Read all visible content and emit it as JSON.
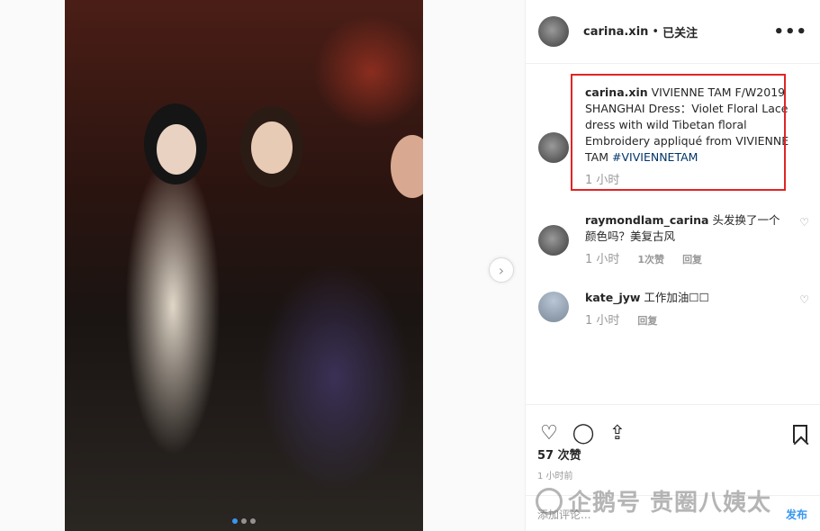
{
  "post": {
    "username": "carina.xin",
    "follow_status": "已关注",
    "separator": "•"
  },
  "caption": {
    "username": "carina.xin",
    "text": "VIVIENNE TAM F/W2019 SHANGHAI Dress：Violet Floral Lace dress with wild Tibetan floral Embroidery appliqué from VIVIENNE TAM",
    "hashtag": "#VIVIENNETAM",
    "time": "1 小时"
  },
  "comments": [
    {
      "username": "raymondlam_carina",
      "text": "头发换了一个颜色吗？美复古风",
      "time": "1 小时",
      "likes": "1次赞",
      "reply": "回复"
    },
    {
      "username": "kate_jyw",
      "text": "工作加油☐☐",
      "time": "1 小时",
      "reply": "回复"
    }
  ],
  "likes_count": "57 次赞",
  "posted_time": "1 小时前",
  "add_comment_placeholder": "添加评论...",
  "post_button": "发布",
  "watermark": "企鹅号 贵圈八姨太",
  "icons": {
    "more": "more-dots-icon",
    "like": "heart-icon",
    "comment": "comment-bubble-icon",
    "share": "share-icon",
    "save": "bookmark-icon",
    "next": "chevron-right-icon"
  },
  "colors": {
    "highlight_box": "#e02525",
    "hashtag": "#003569",
    "active_dot": "#3897f0"
  },
  "carousel": {
    "total_dots": 3,
    "active_index": 0
  }
}
